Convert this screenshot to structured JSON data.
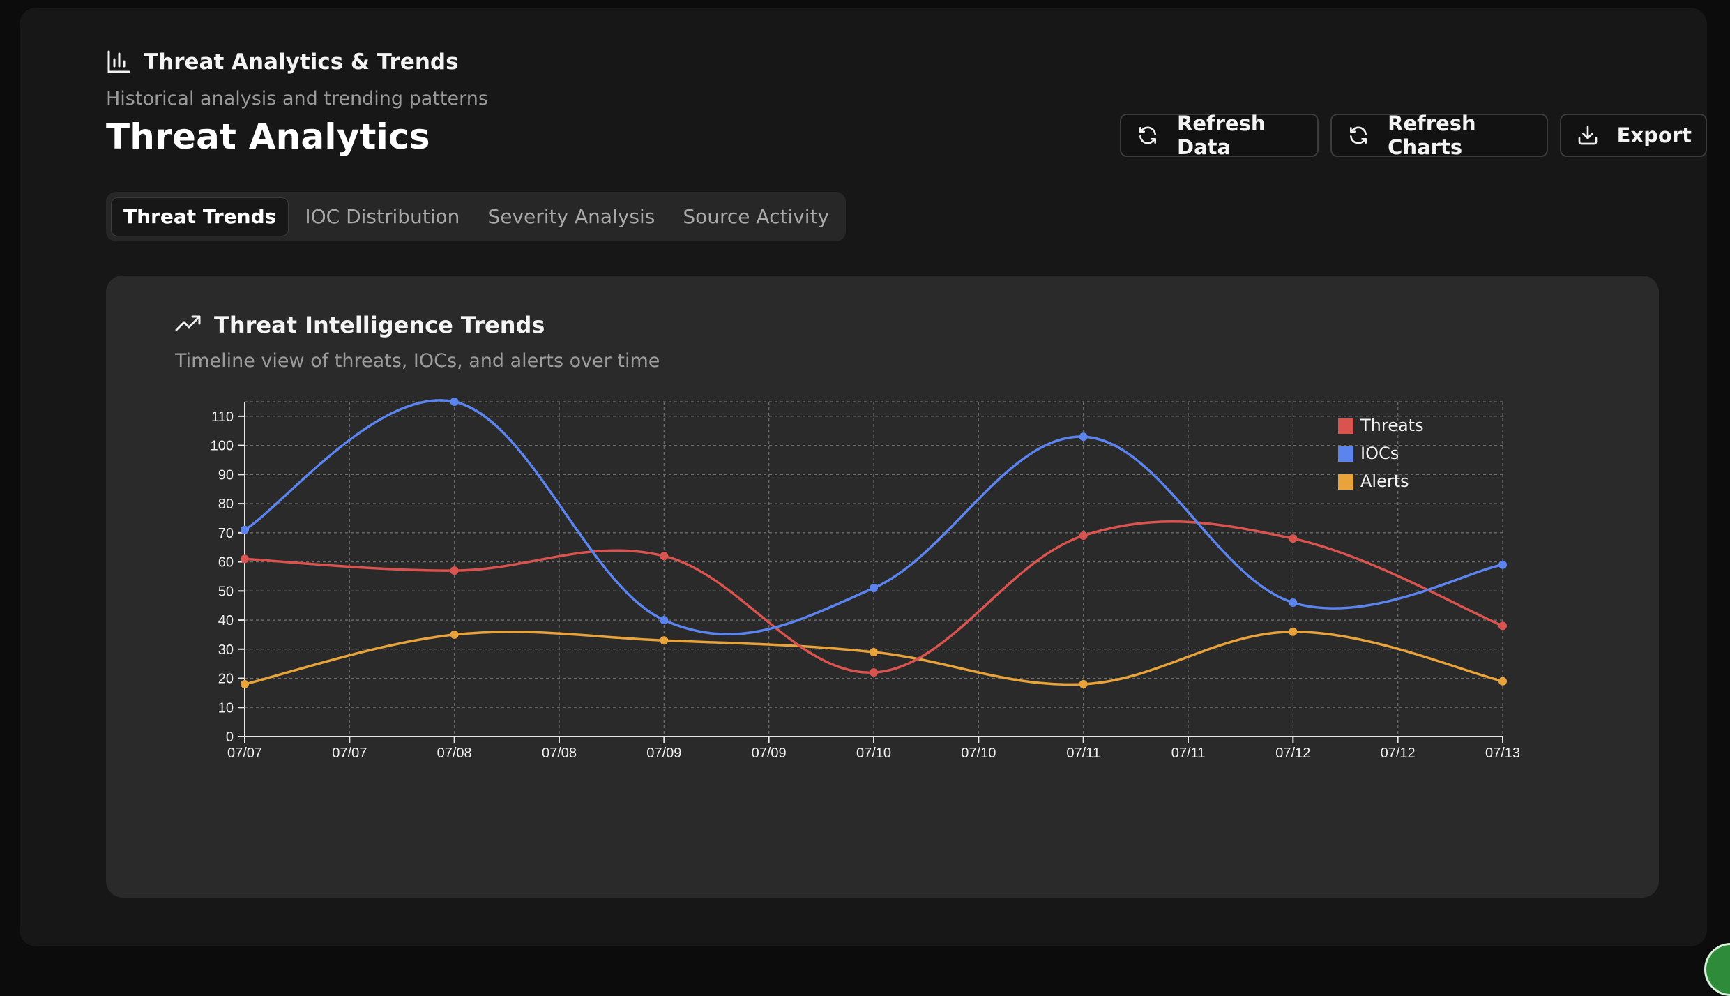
{
  "header": {
    "title": "Threat Analytics & Trends",
    "subtitle": "Historical analysis and trending patterns",
    "page_title": "Threat Analytics",
    "icon": "bar-chart-icon"
  },
  "toolbar": {
    "refresh_data_label": "Refresh Data",
    "refresh_charts_label": "Refresh Charts",
    "export_label": "Export"
  },
  "tabs": [
    {
      "label": "Threat Trends",
      "active": true
    },
    {
      "label": "IOC Distribution",
      "active": false
    },
    {
      "label": "Severity Analysis",
      "active": false
    },
    {
      "label": "Source Activity",
      "active": false
    }
  ],
  "card": {
    "title": "Threat Intelligence Trends",
    "subtitle": "Timeline view of threats, IOCs, and alerts over time",
    "icon": "trending-up-icon"
  },
  "colors": {
    "threats": "#d9534f",
    "iocs": "#5b84ef",
    "alerts": "#e8a33b"
  },
  "chart_data": {
    "type": "line",
    "title": "",
    "xlabel": "",
    "ylabel": "",
    "categories": [
      "07/07",
      "07/07",
      "07/08",
      "07/08",
      "07/09",
      "07/09",
      "07/10",
      "07/10",
      "07/11",
      "07/11",
      "07/12",
      "07/12",
      "07/13"
    ],
    "ylim": [
      0,
      115
    ],
    "yticks": [
      0,
      10,
      20,
      30,
      40,
      50,
      60,
      70,
      80,
      90,
      100,
      110
    ],
    "grid": true,
    "legend_position": "top-right",
    "series": [
      {
        "name": "Threats",
        "values": [
          61,
          57,
          62,
          22,
          69,
          68,
          38
        ],
        "x_index": [
          0,
          2,
          4,
          6,
          8,
          10,
          12
        ]
      },
      {
        "name": "IOCs",
        "values": [
          71,
          115,
          40,
          51,
          103,
          46,
          59
        ],
        "x_index": [
          0,
          2,
          4,
          6,
          8,
          10,
          12
        ]
      },
      {
        "name": "Alerts",
        "values": [
          18,
          35,
          33,
          29,
          18,
          36,
          19
        ],
        "x_index": [
          0,
          2,
          4,
          6,
          8,
          10,
          12
        ]
      }
    ]
  }
}
